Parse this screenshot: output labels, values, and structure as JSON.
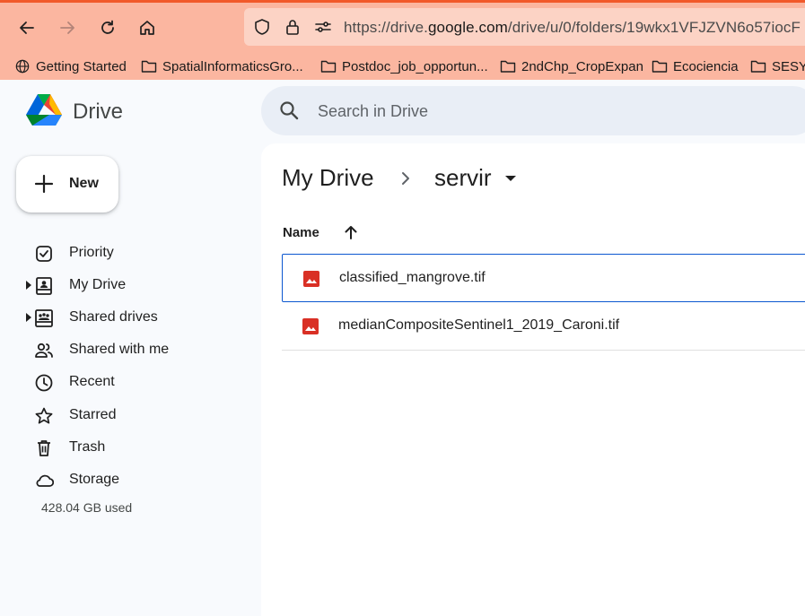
{
  "browser": {
    "url_prefix": "https://drive.",
    "url_domain": "google.com",
    "url_suffix": "/drive/u/0/folders/19wkx1VFJZVN6o57iocF",
    "bookmarks": [
      {
        "label": "Getting Started",
        "icon": "globe-icon"
      },
      {
        "label": "SpatialInformaticsGro...",
        "icon": "folder-icon"
      },
      {
        "label": "Postdoc_job_opportun...",
        "icon": "folder-icon"
      },
      {
        "label": "2ndChp_CropExpan",
        "icon": "folder-icon"
      },
      {
        "label": "Ecociencia",
        "icon": "folder-icon"
      },
      {
        "label": "SESYN",
        "icon": "folder-icon"
      }
    ],
    "chrome_color": "#fbb6a0",
    "accent_color": "#f1592a"
  },
  "app": {
    "brand": "Drive",
    "search_placeholder": "Search in Drive"
  },
  "sidebar": {
    "new_label": "New",
    "items": [
      {
        "label": "Priority",
        "icon": "priority-icon"
      },
      {
        "label": "My Drive",
        "icon": "my-drive-icon"
      },
      {
        "label": "Shared drives",
        "icon": "shared-drives-icon"
      },
      {
        "label": "Shared with me",
        "icon": "shared-with-me-icon"
      },
      {
        "label": "Recent",
        "icon": "clock-icon"
      },
      {
        "label": "Starred",
        "icon": "star-icon"
      },
      {
        "label": "Trash",
        "icon": "trash-icon"
      },
      {
        "label": "Storage",
        "icon": "cloud-icon"
      }
    ],
    "storage_used": "428.04 GB used"
  },
  "main": {
    "breadcrumb_root": "My Drive",
    "breadcrumb_current": "servir",
    "column_name": "Name",
    "files": [
      {
        "name": "classified_mangrove.tif",
        "icon": "image-file-icon",
        "selected": true
      },
      {
        "name": "medianCompositeSentinel1_2019_Caroni.tif",
        "icon": "image-file-icon",
        "selected": false
      }
    ],
    "file_icon_color": "#d93025",
    "selection_color": "#0b57d0"
  }
}
